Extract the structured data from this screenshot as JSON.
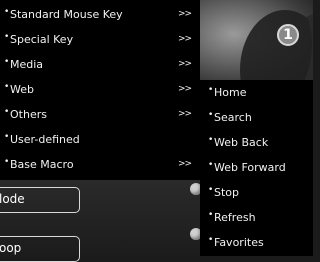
{
  "menu": {
    "items": [
      {
        "label": "Standard Mouse Key",
        "arrow": ">>"
      },
      {
        "label": "Special Key",
        "arrow": ">>"
      },
      {
        "label": "Media",
        "arrow": ">>"
      },
      {
        "label": "Web",
        "arrow": ">>"
      },
      {
        "label": "Others",
        "arrow": ">>"
      },
      {
        "label": "User-defined",
        "arrow": ""
      },
      {
        "label": "Base Macro",
        "arrow": ">>"
      }
    ]
  },
  "submenu": {
    "items": [
      {
        "label": "Home"
      },
      {
        "label": "Search"
      },
      {
        "label": "Web Back"
      },
      {
        "label": "Web Forward"
      },
      {
        "label": "Stop"
      },
      {
        "label": "Refresh"
      },
      {
        "label": "Favorites"
      }
    ]
  },
  "background": {
    "badge_number": "1",
    "mode_label": "lode",
    "loop_label": "oop"
  },
  "bullet": "•"
}
